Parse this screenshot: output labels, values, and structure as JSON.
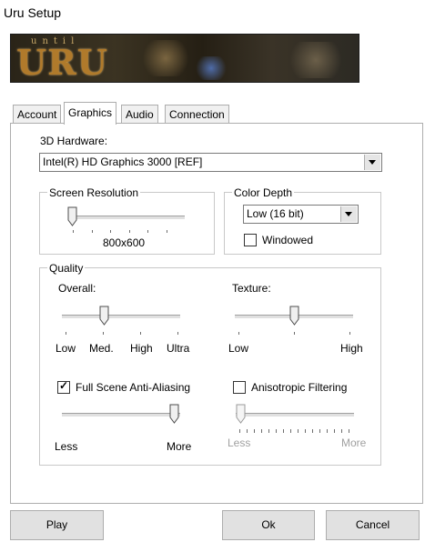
{
  "window": {
    "title": "Uru Setup"
  },
  "banner": {
    "small_text": "until",
    "big_text": "URU"
  },
  "tabs": [
    {
      "label": "Account"
    },
    {
      "label": "Graphics"
    },
    {
      "label": "Audio"
    },
    {
      "label": "Connection"
    }
  ],
  "hardware": {
    "label": "3D Hardware:",
    "value": "Intel(R) HD Graphics 3000 [REF]"
  },
  "resolution": {
    "legend": "Screen Resolution",
    "value_label": "800x600",
    "slider_position": 0
  },
  "color_depth": {
    "legend": "Color Depth",
    "value": "Low (16 bit)",
    "windowed_label": "Windowed",
    "windowed_checked": false
  },
  "quality": {
    "legend": "Quality",
    "overall": {
      "label": "Overall:",
      "ticks": [
        "Low",
        "Med.",
        "High",
        "Ultra"
      ],
      "selected": "Med."
    },
    "texture": {
      "label": "Texture:",
      "ticks": [
        "Low",
        "High"
      ],
      "level": 0.5
    },
    "antialias": {
      "label": "Full Scene Anti-Aliasing",
      "checked": true,
      "less": "Less",
      "more": "More",
      "level": 1.0
    },
    "anisotropic": {
      "label": "Anisotropic Filtering",
      "checked": false,
      "less": "Less",
      "more": "More",
      "level": 0.0,
      "enabled": false
    }
  },
  "buttons": {
    "play": "Play",
    "ok": "Ok",
    "cancel": "Cancel"
  }
}
